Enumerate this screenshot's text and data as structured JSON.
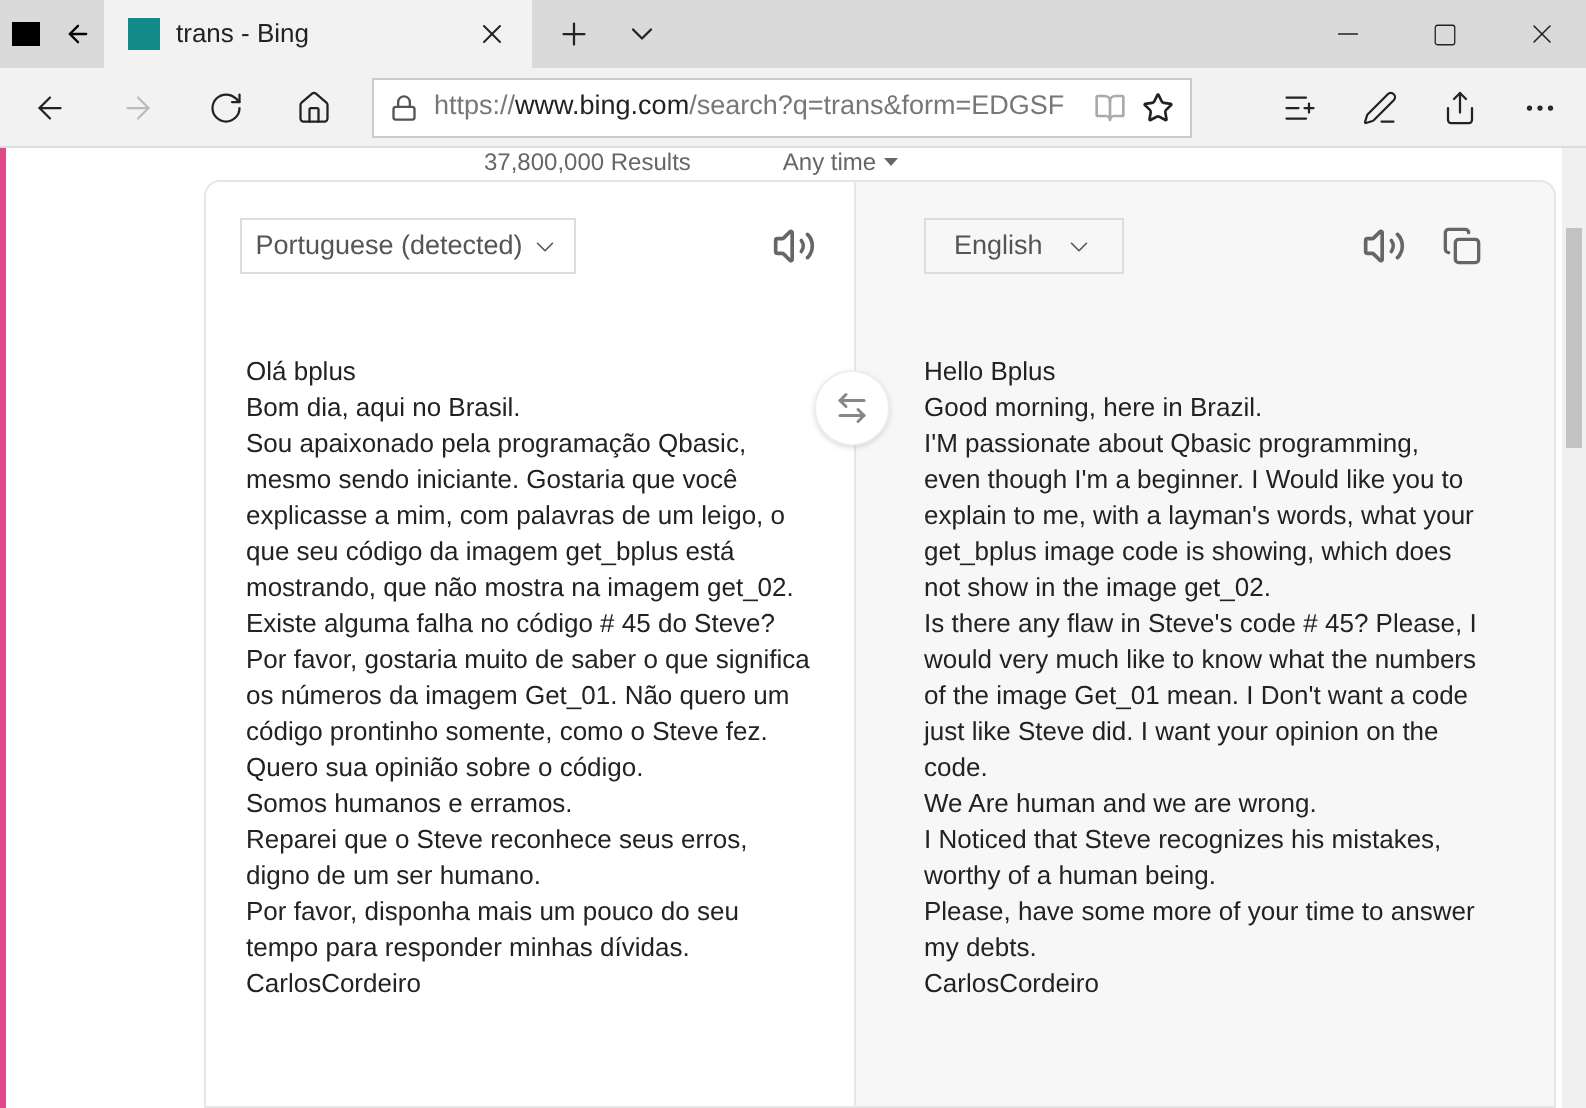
{
  "browser": {
    "tabs": [
      {
        "title": "trans - Bing",
        "selected": true
      }
    ],
    "address": {
      "scheme": "https://",
      "host": "www.bing.com",
      "path": "/search?q=trans&form=EDGSF"
    },
    "forward_disabled": true
  },
  "results_bar": {
    "count": "37,800,000 Results",
    "filter": "Any time"
  },
  "translator": {
    "source": {
      "language": "Portuguese (detected)",
      "paragraphs": [
        "Olá bplus",
        "Bom dia, aqui no Brasil.",
        "Sou apaixonado pela programação Qbasic, mesmo sendo iniciante. Gostaria que você explicasse a mim, com palavras de um leigo, o que seu código da imagem get_bplus está mostrando, que não mostra na imagem get_02.",
        "Existe alguma falha no código # 45 do Steve?",
        "Por favor, gostaria muito de saber o que significa os números da imagem Get_01. Não quero um código prontinho somente, como o Steve fez. Quero sua opinião sobre o código.",
        "Somos humanos e erramos.",
        "Reparei que o Steve reconhece seus erros, digno de um ser humano.",
        "Por favor, disponha mais um pouco do seu tempo para responder minhas dívidas.",
        "CarlosCordeiro"
      ]
    },
    "target": {
      "language": "English",
      "paragraphs": [
        "Hello Bplus",
        "Good morning, here in Brazil.",
        "I'M passionate about Qbasic programming, even though I'm a beginner. I Would like you to explain to me, with a layman's words, what your get_bplus image code is showing, which does not show in the image get_02.",
        "Is there any flaw in Steve's code # 45? Please, I would very much like to know what the numbers of the image Get_01 mean. I Don't want a code just like Steve did. I want your opinion on the code.",
        "We Are human and we are wrong.",
        "I Noticed that Steve recognizes his mistakes, worthy of a human being.",
        "Please, have some more of your time to answer my debts.",
        "CarlosCordeiro"
      ]
    }
  }
}
